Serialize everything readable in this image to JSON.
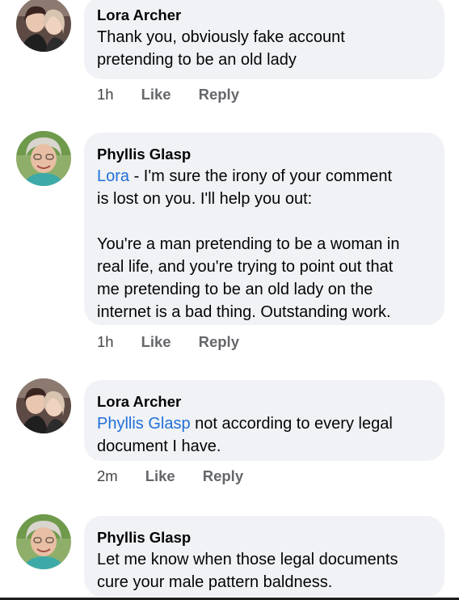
{
  "comments": [
    {
      "author": "Lora Archer",
      "mention": "",
      "text_1": "Thank you, obviously fake account",
      "text_2": "pretending to be an old lady",
      "time": "1h",
      "like": "Like",
      "reply": "Reply"
    },
    {
      "author": "Phyllis Glasp",
      "mention": "Lora",
      "text_1a": " - I'm sure the irony of your comment",
      "text_1b": "is lost on you. I'll help you out:",
      "text_2a": "You're a man pretending to be a woman in",
      "text_2b": "real life, and you're trying to point out that",
      "text_2c": "me pretending to be an old lady on the",
      "text_2d": "internet is a bad thing. Outstanding work.",
      "time": "1h",
      "like": "Like",
      "reply": "Reply"
    },
    {
      "author": "Lora Archer",
      "mention": "Phyllis Glasp",
      "text_1a": " not according to every legal",
      "text_1b": "document I have.",
      "time": "2m",
      "like": "Like",
      "reply": "Reply"
    },
    {
      "author": "Phyllis Glasp",
      "text_1": "Let me know when those legal documents",
      "text_2": "cure your male pattern baldness."
    }
  ]
}
